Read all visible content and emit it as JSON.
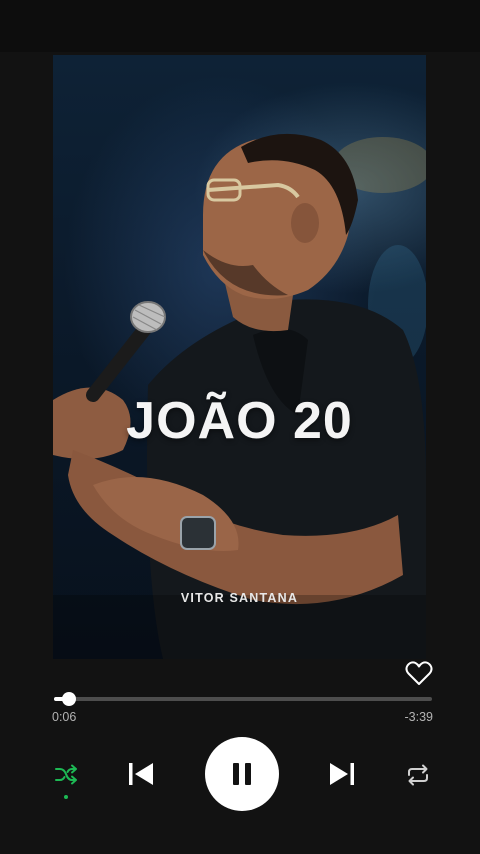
{
  "track": {
    "cover_title": "JOÃO 20",
    "cover_artist": "VITOR SANTANA"
  },
  "player": {
    "elapsed": "0:06",
    "remaining": "-3:39",
    "progress": 0.04,
    "shuffle_active": true,
    "liked": false,
    "state": "playing"
  },
  "colors": {
    "background": "#121212",
    "accent": "#1db954",
    "text_secondary": "#b3b3b3"
  },
  "icons": [
    "heart-icon",
    "shuffle-icon",
    "previous-icon",
    "pause-icon",
    "next-icon",
    "repeat-icon"
  ]
}
